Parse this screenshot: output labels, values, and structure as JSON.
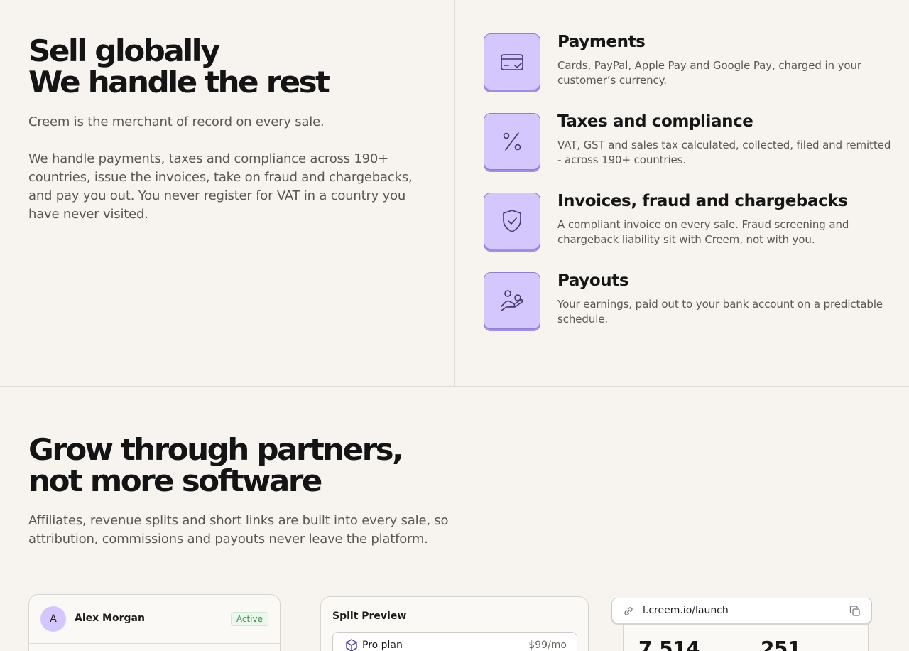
{
  "hero": {
    "title_line1": "Sell globally",
    "title_line2": "We handle the rest",
    "lead1": "Creem is the merchant of record on every sale.",
    "lead2": "We handle payments, taxes and compliance across 190+ countries, issue the invoices, take on fraud and chargebacks, and pay you out. You never register for VAT in a country you have never visited."
  },
  "features": [
    {
      "icon": "credit-card-icon",
      "title": "Payments",
      "desc": "Cards, PayPal, Apple Pay and Google Pay, charged in your customer’s currency."
    },
    {
      "icon": "percent-icon",
      "title": "Taxes and compliance",
      "desc": "VAT, GST and sales tax calculated, collected, filed and remitted - across 190+ countries."
    },
    {
      "icon": "shield-check-icon",
      "title": "Invoices, fraud and chargebacks",
      "desc": "A compliant invoice on every sale. Fraud screening and chargeback liability sit with Creem, not with you."
    },
    {
      "icon": "hand-coins-icon",
      "title": "Payouts",
      "desc": "Your earnings, paid out to your bank account on a predictable schedule."
    }
  ],
  "partners": {
    "title_line1": "Grow through partners,",
    "title_line2": "not more software",
    "lead": "Affiliates, revenue splits and short links are built into every sale, so attribution, commissions and payouts never leave the platform."
  },
  "affiliate_card": {
    "avatar_letter": "A",
    "name": "Alex Morgan",
    "status": "Active"
  },
  "split_card": {
    "title": "Split Preview",
    "plan_name": "Pro plan",
    "plan_price": "$99/mo"
  },
  "link_card": {
    "url": "l.creem.io/launch",
    "stat1": "7,514",
    "stat2": "251"
  },
  "colors": {
    "accent": "#d3c7fd",
    "accent_border": "#8e7fd0",
    "bg": "#f7f4f0",
    "active_green": "#2f9a4a"
  }
}
